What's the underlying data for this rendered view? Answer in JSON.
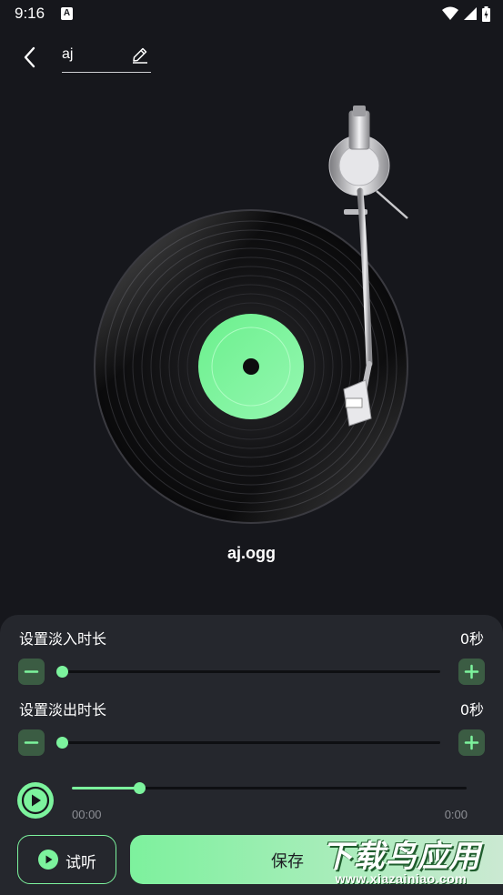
{
  "status_bar": {
    "time": "9:16",
    "notification_badge": "A",
    "icons": [
      "wifi-icon",
      "signal-icon",
      "battery-icon"
    ]
  },
  "header": {
    "name_value": "aj",
    "back_icon": "back-arrow-icon",
    "edit_icon": "pencil-icon"
  },
  "player": {
    "filename": "aj.ogg",
    "label_color": "#7cf39d"
  },
  "fade_in": {
    "label": "设置淡入时长",
    "value": "0秒",
    "level": 0
  },
  "fade_out": {
    "label": "设置淡出时长",
    "value": "0秒",
    "level": 0
  },
  "playback": {
    "current_time": "00:00",
    "total_time": "0:00",
    "progress": 0.17
  },
  "actions": {
    "preview_label": "试听",
    "save_label": "保存"
  },
  "watermark": {
    "title": "下载鸟应用",
    "url": "www.xiazainiao.com"
  },
  "colors": {
    "accent": "#7cf39d",
    "background": "#16171c",
    "panel": "#25272d"
  }
}
